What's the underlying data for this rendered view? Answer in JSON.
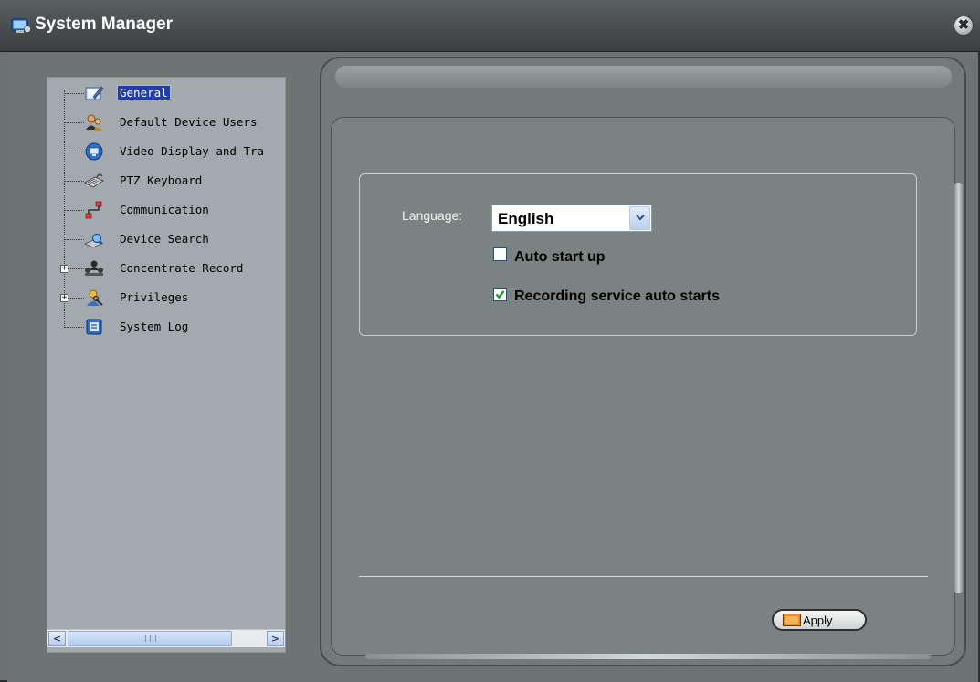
{
  "window": {
    "title": "System Manager",
    "close_glyph": "✖"
  },
  "tree": {
    "items": [
      {
        "label": "General",
        "icon": "general-settings-icon",
        "selected": true
      },
      {
        "label": "Default Device Users",
        "icon": "users-icon"
      },
      {
        "label": "Video Display and Tra",
        "icon": "monitor-icon"
      },
      {
        "label": "PTZ Keyboard",
        "icon": "keyboard-icon"
      },
      {
        "label": "Communication",
        "icon": "network-icon"
      },
      {
        "label": "Device Search",
        "icon": "search-device-icon"
      },
      {
        "label": "Concentrate Record",
        "icon": "record-icon",
        "expandable": true
      },
      {
        "label": "Privileges",
        "icon": "privileges-icon",
        "expandable": true
      },
      {
        "label": "System Log",
        "icon": "log-icon"
      }
    ],
    "expander_glyph": "+"
  },
  "scrollbar": {
    "left_arrow": "<",
    "right_arrow": ">"
  },
  "general": {
    "language_label": "Language:",
    "language_value": "English",
    "auto_start_label": "Auto start up",
    "auto_start_checked": false,
    "recording_label": "Recording service auto starts",
    "recording_checked": true
  },
  "actions": {
    "apply_label": "Apply"
  },
  "colors": {
    "selection": "#1f3fa8",
    "apply_icon": "#f08a1b",
    "check": "#1e9a1e"
  }
}
